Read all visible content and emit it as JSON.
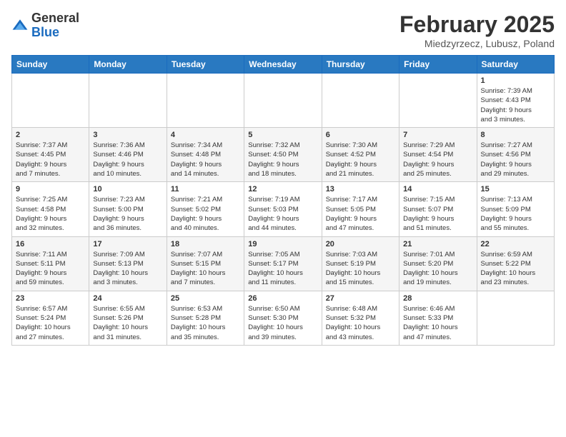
{
  "header": {
    "logo_general": "General",
    "logo_blue": "Blue",
    "month_title": "February 2025",
    "location": "Miedzyrzecz, Lubusz, Poland"
  },
  "weekdays": [
    "Sunday",
    "Monday",
    "Tuesday",
    "Wednesday",
    "Thursday",
    "Friday",
    "Saturday"
  ],
  "weeks": [
    [
      {
        "day": "",
        "info": ""
      },
      {
        "day": "",
        "info": ""
      },
      {
        "day": "",
        "info": ""
      },
      {
        "day": "",
        "info": ""
      },
      {
        "day": "",
        "info": ""
      },
      {
        "day": "",
        "info": ""
      },
      {
        "day": "1",
        "info": "Sunrise: 7:39 AM\nSunset: 4:43 PM\nDaylight: 9 hours\nand 3 minutes."
      }
    ],
    [
      {
        "day": "2",
        "info": "Sunrise: 7:37 AM\nSunset: 4:45 PM\nDaylight: 9 hours\nand 7 minutes."
      },
      {
        "day": "3",
        "info": "Sunrise: 7:36 AM\nSunset: 4:46 PM\nDaylight: 9 hours\nand 10 minutes."
      },
      {
        "day": "4",
        "info": "Sunrise: 7:34 AM\nSunset: 4:48 PM\nDaylight: 9 hours\nand 14 minutes."
      },
      {
        "day": "5",
        "info": "Sunrise: 7:32 AM\nSunset: 4:50 PM\nDaylight: 9 hours\nand 18 minutes."
      },
      {
        "day": "6",
        "info": "Sunrise: 7:30 AM\nSunset: 4:52 PM\nDaylight: 9 hours\nand 21 minutes."
      },
      {
        "day": "7",
        "info": "Sunrise: 7:29 AM\nSunset: 4:54 PM\nDaylight: 9 hours\nand 25 minutes."
      },
      {
        "day": "8",
        "info": "Sunrise: 7:27 AM\nSunset: 4:56 PM\nDaylight: 9 hours\nand 29 minutes."
      }
    ],
    [
      {
        "day": "9",
        "info": "Sunrise: 7:25 AM\nSunset: 4:58 PM\nDaylight: 9 hours\nand 32 minutes."
      },
      {
        "day": "10",
        "info": "Sunrise: 7:23 AM\nSunset: 5:00 PM\nDaylight: 9 hours\nand 36 minutes."
      },
      {
        "day": "11",
        "info": "Sunrise: 7:21 AM\nSunset: 5:02 PM\nDaylight: 9 hours\nand 40 minutes."
      },
      {
        "day": "12",
        "info": "Sunrise: 7:19 AM\nSunset: 5:03 PM\nDaylight: 9 hours\nand 44 minutes."
      },
      {
        "day": "13",
        "info": "Sunrise: 7:17 AM\nSunset: 5:05 PM\nDaylight: 9 hours\nand 47 minutes."
      },
      {
        "day": "14",
        "info": "Sunrise: 7:15 AM\nSunset: 5:07 PM\nDaylight: 9 hours\nand 51 minutes."
      },
      {
        "day": "15",
        "info": "Sunrise: 7:13 AM\nSunset: 5:09 PM\nDaylight: 9 hours\nand 55 minutes."
      }
    ],
    [
      {
        "day": "16",
        "info": "Sunrise: 7:11 AM\nSunset: 5:11 PM\nDaylight: 9 hours\nand 59 minutes."
      },
      {
        "day": "17",
        "info": "Sunrise: 7:09 AM\nSunset: 5:13 PM\nDaylight: 10 hours\nand 3 minutes."
      },
      {
        "day": "18",
        "info": "Sunrise: 7:07 AM\nSunset: 5:15 PM\nDaylight: 10 hours\nand 7 minutes."
      },
      {
        "day": "19",
        "info": "Sunrise: 7:05 AM\nSunset: 5:17 PM\nDaylight: 10 hours\nand 11 minutes."
      },
      {
        "day": "20",
        "info": "Sunrise: 7:03 AM\nSunset: 5:19 PM\nDaylight: 10 hours\nand 15 minutes."
      },
      {
        "day": "21",
        "info": "Sunrise: 7:01 AM\nSunset: 5:20 PM\nDaylight: 10 hours\nand 19 minutes."
      },
      {
        "day": "22",
        "info": "Sunrise: 6:59 AM\nSunset: 5:22 PM\nDaylight: 10 hours\nand 23 minutes."
      }
    ],
    [
      {
        "day": "23",
        "info": "Sunrise: 6:57 AM\nSunset: 5:24 PM\nDaylight: 10 hours\nand 27 minutes."
      },
      {
        "day": "24",
        "info": "Sunrise: 6:55 AM\nSunset: 5:26 PM\nDaylight: 10 hours\nand 31 minutes."
      },
      {
        "day": "25",
        "info": "Sunrise: 6:53 AM\nSunset: 5:28 PM\nDaylight: 10 hours\nand 35 minutes."
      },
      {
        "day": "26",
        "info": "Sunrise: 6:50 AM\nSunset: 5:30 PM\nDaylight: 10 hours\nand 39 minutes."
      },
      {
        "day": "27",
        "info": "Sunrise: 6:48 AM\nSunset: 5:32 PM\nDaylight: 10 hours\nand 43 minutes."
      },
      {
        "day": "28",
        "info": "Sunrise: 6:46 AM\nSunset: 5:33 PM\nDaylight: 10 hours\nand 47 minutes."
      },
      {
        "day": "",
        "info": ""
      }
    ]
  ]
}
